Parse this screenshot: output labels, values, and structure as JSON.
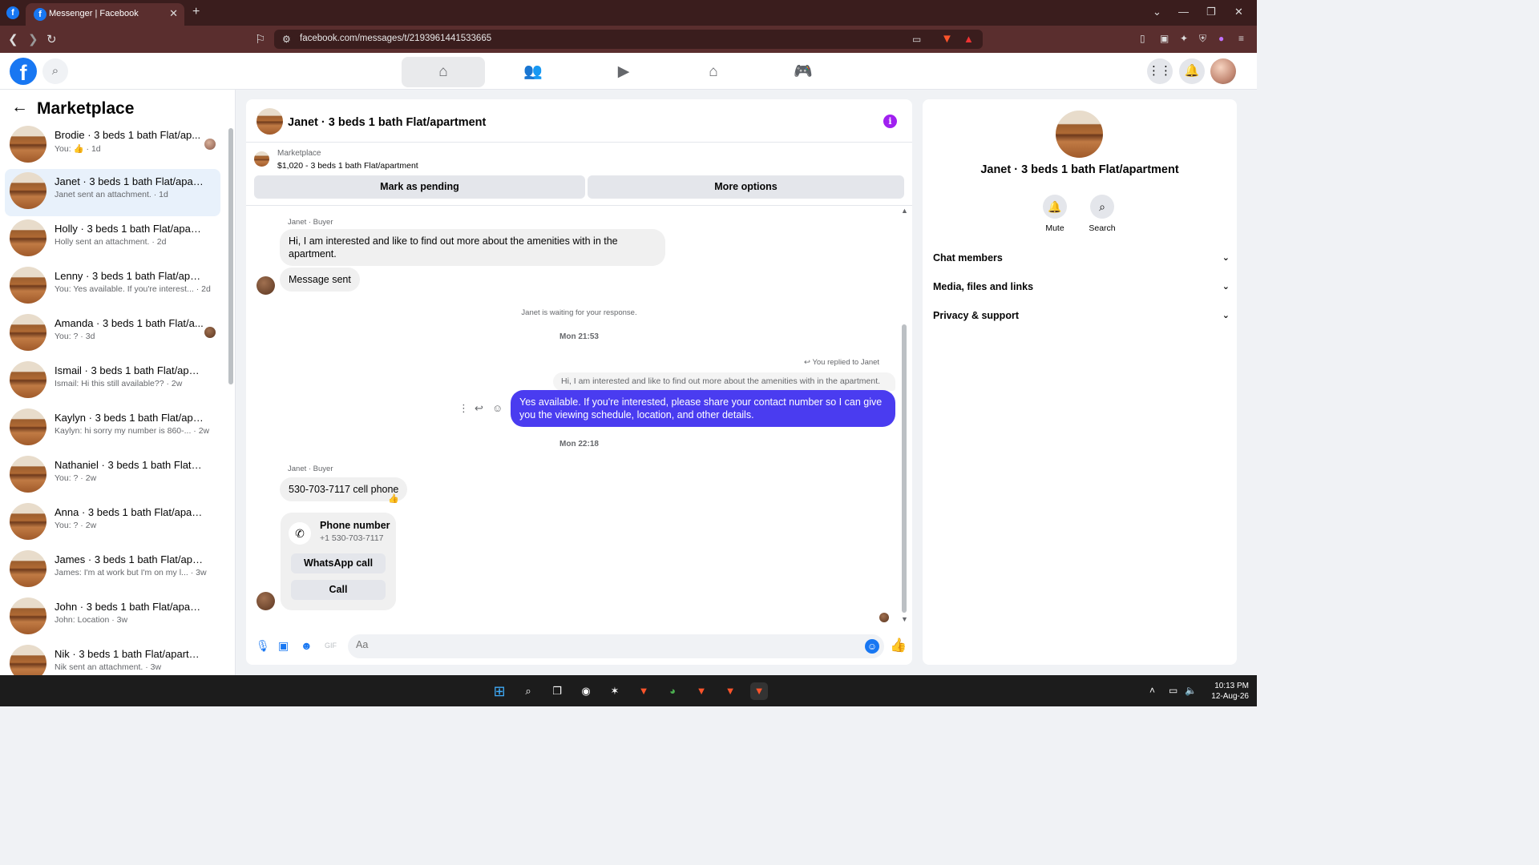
{
  "browser": {
    "tab_title": "Messenger | Facebook",
    "url": "facebook.com/messages/t/2193961441533665"
  },
  "sidebar": {
    "title": "Marketplace",
    "conversations": [
      {
        "name": "Brodie · 3 beds 1 bath Flat/ap...",
        "preview": "You: 👍 · 1d"
      },
      {
        "name": "Janet · 3 beds 1 bath Flat/apart...",
        "preview": "Janet sent an attachment. · 1d"
      },
      {
        "name": "Holly · 3 beds 1 bath Flat/apart...",
        "preview": "Holly sent an attachment. · 2d"
      },
      {
        "name": "Lenny · 3 beds 1 bath Flat/apart...",
        "preview": "You: Yes available. If you're interest... · 2d"
      },
      {
        "name": "Amanda · 3 beds 1 bath Flat/a...",
        "preview": "You: ? · 3d"
      },
      {
        "name": "Ismail · 3 beds 1 bath Flat/apart...",
        "preview": "Ismail: Hi this still available?? · 2w"
      },
      {
        "name": "Kaylyn · 3 beds 1 bath Flat/apart...",
        "preview": "Kaylyn: hi sorry my number is 860-... · 2w"
      },
      {
        "name": "Nathaniel · 3 beds 1 bath Flat/ap...",
        "preview": "You: ? · 2w"
      },
      {
        "name": "Anna · 3 beds 1 bath Flat/apart...",
        "preview": "You: ? · 2w"
      },
      {
        "name": "James · 3 beds 1 bath Flat/apart...",
        "preview": "James: I'm at work but I'm on my l... · 3w"
      },
      {
        "name": "John · 3 beds 1 bath Flat/apartm...",
        "preview": "John: Location · 3w"
      },
      {
        "name": "Nik · 3 beds 1 bath Flat/apartment",
        "preview": "Nik sent an attachment. · 3w"
      }
    ]
  },
  "chat": {
    "title": "Janet · 3 beds 1 bath Flat/apartment",
    "marketplace_label": "Marketplace",
    "listing": "$1,020 - 3 beds 1 bath Flat/apartment",
    "mark_pending": "Mark as pending",
    "more_options": "More options",
    "sender_label": "Janet · Buyer",
    "msg1": "Hi, I am interested and like to find out more about the amenities with in the apartment.",
    "msg2": "Message sent",
    "waiting": "Janet is waiting for your response.",
    "time1": "Mon 21:53",
    "replied_note": "You replied to Janet",
    "quoted": "Hi, I am interested and like to find out more about the amenities with in the apartment.",
    "my_reply": "Yes available. If you're interested, please share your contact number so I can give you the viewing schedule, location, and other details.",
    "time2": "Mon 22:18",
    "sender_label2": "Janet · Buyer",
    "msg3": "530-703-7117 cell phone",
    "phone_card": {
      "title": "Phone number",
      "number": "+1 530-703-7117",
      "whatsapp": "WhatsApp call",
      "call": "Call"
    },
    "composer_placeholder": "Aa"
  },
  "right_panel": {
    "title": "Janet · 3 beds 1 bath Flat/apartment",
    "mute": "Mute",
    "search": "Search",
    "sections": [
      "Chat members",
      "Media, files and links",
      "Privacy & support"
    ]
  },
  "taskbar": {
    "time": "10:13 PM",
    "date": "12-Aug-26"
  },
  "colors": {
    "fb_blue": "#1877f2",
    "my_bubble": "#4a3cf0",
    "info_purple": "#a020f0"
  }
}
